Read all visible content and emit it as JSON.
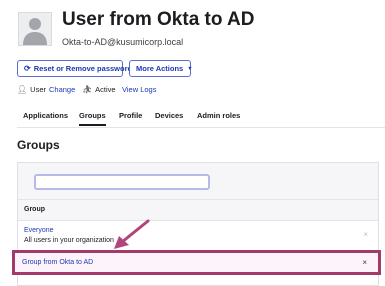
{
  "user": {
    "name": "User from Okta to AD",
    "email": "Okta-to-AD@kusumicorp.local"
  },
  "actions": {
    "reset_label": "Reset or Remove password",
    "more_label": "More Actions"
  },
  "status": {
    "type_label": "User",
    "change_label": "Change",
    "state_label": "Active",
    "logs_label": "View Logs"
  },
  "tabs": [
    {
      "label": "Applications",
      "active": false
    },
    {
      "label": "Groups",
      "active": true
    },
    {
      "label": "Profile",
      "active": false
    },
    {
      "label": "Devices",
      "active": false
    },
    {
      "label": "Admin roles",
      "active": false
    }
  ],
  "groups": {
    "title": "Groups",
    "search_value": "",
    "column_header": "Group",
    "rows": [
      {
        "name": "Everyone",
        "description": "All users in your organization",
        "remove": "×"
      },
      {
        "name": "Group from Okta to AD",
        "description": "",
        "remove": "×"
      }
    ]
  },
  "colors": {
    "link": "#1c39b6",
    "highlight_border": "#a23a6a",
    "highlight_fill": "#fdf3fb"
  }
}
